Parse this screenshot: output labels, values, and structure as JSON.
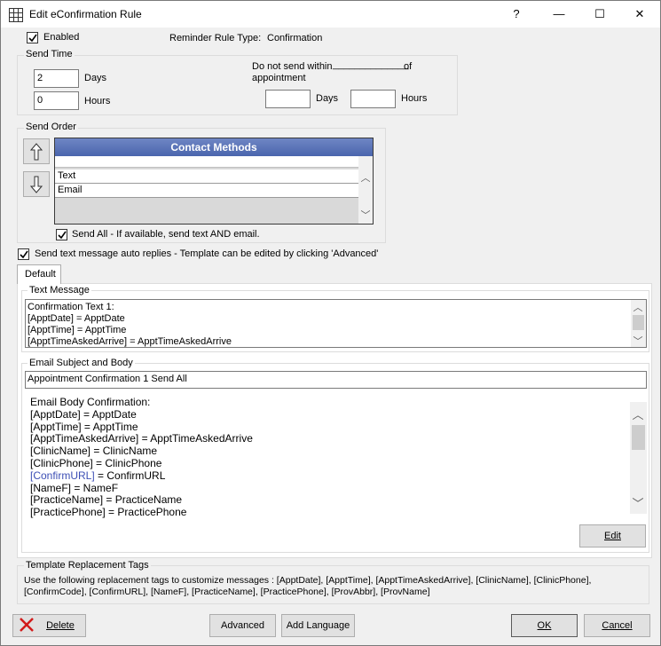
{
  "window": {
    "title": "Edit eConfirmation Rule",
    "help_label": "?",
    "minimize_label": "—",
    "maximize_label": "☐",
    "close_label": "✕"
  },
  "enabled": {
    "label": "Enabled",
    "checked": true
  },
  "reminder_rule_type": {
    "label": "Reminder Rule Type:",
    "value": "Confirmation"
  },
  "send_time": {
    "title": "Send Time",
    "days_value": "2",
    "days_label": "Days",
    "hours_value": "0",
    "hours_label": "Hours",
    "do_not_send_label_1": "Do not send within",
    "do_not_send_blank": "______________",
    "do_not_send_label_2": "of",
    "do_not_send_label_3": "appointment",
    "within_days_value": "",
    "within_days_label": "Days",
    "within_hours_value": "",
    "within_hours_label": "Hours"
  },
  "send_order": {
    "title": "Send Order",
    "grid_header": "Contact Methods",
    "rows": [
      "Text",
      "Email"
    ],
    "send_all_label": "Send All - If available, send text AND email.",
    "send_all_checked": true
  },
  "auto_replies": {
    "label": "Send text message auto replies - Template can be edited by clicking 'Advanced'",
    "checked": true
  },
  "tabs": [
    {
      "label": "Default"
    }
  ],
  "text_message": {
    "title": "Text Message",
    "lines": [
      "Confirmation Text 1:",
      "[ApptDate] = ApptDate",
      "[ApptTime] = ApptTime",
      "[ApptTimeAskedArrive] = ApptTimeAskedArrive"
    ]
  },
  "email": {
    "title": "Email Subject and Body",
    "subject": "Appointment Confirmation 1 Send All",
    "body_lines": [
      "Email Body Confirmation:",
      "[ApptDate] = ApptDate",
      "[ApptTime] = ApptTime",
      "[ApptTimeAskedArrive] = ApptTimeAskedArrive",
      "[ClinicName] = ClinicName",
      "[ClinicPhone] = ClinicPhone",
      "[ConfirmURL] = ConfirmURL",
      "[NameF] = NameF",
      "[PracticeName] = PracticeName",
      "[PracticePhone] = PracticePhone"
    ],
    "link_color": "#3d4fb5",
    "edit_label": "Edit"
  },
  "replacement_tags": {
    "title": "Template Replacement Tags",
    "text_line1": "Use the following replacement tags to customize messages : [ApptDate], [ApptTime], [ApptTimeAskedArrive], [ClinicName], [ClinicPhone],",
    "text_line2": "[ConfirmCode], [ConfirmURL], [NameF], [PracticeName], [PracticePhone], [ProvAbbr], [ProvName]"
  },
  "buttons": {
    "delete": "Delete",
    "advanced": "Advanced",
    "add_language": "Add Language",
    "ok": "OK",
    "cancel": "Cancel"
  },
  "icons": {
    "title_icon": "grid-icon",
    "up": "arrow-up-icon",
    "down": "arrow-down-icon",
    "delete": "red-x-icon"
  }
}
